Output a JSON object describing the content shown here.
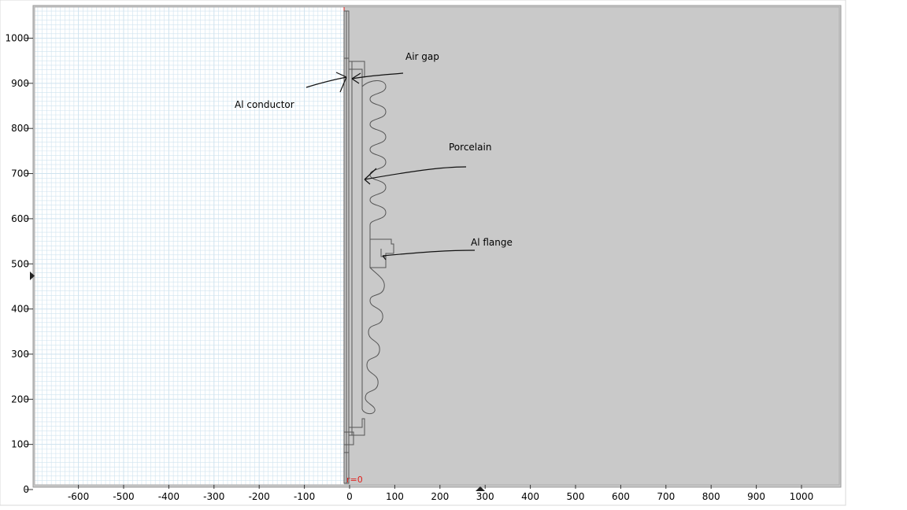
{
  "view": {
    "x_ticks": [
      "-600",
      "-500",
      "-400",
      "-300",
      "-200",
      "-100",
      "0",
      "100",
      "200",
      "300",
      "400",
      "500",
      "600",
      "700",
      "800",
      "900",
      "1000"
    ],
    "y_ticks": [
      "0",
      "100",
      "200",
      "300",
      "400",
      "500",
      "600",
      "700",
      "800",
      "900",
      "1000"
    ],
    "colors": {
      "background": "#c9c9c9",
      "grid_bg": "#ffffff",
      "grid_line": "#cfe3ef",
      "axis_line": "#e0201c",
      "outline": "#5a5a5a"
    }
  },
  "axis_label": "r=0",
  "annotations": {
    "air_gap": "Air gap",
    "al_conductor": "Al conductor",
    "porcelain": "Porcelain",
    "al_flange": "Al flange"
  }
}
